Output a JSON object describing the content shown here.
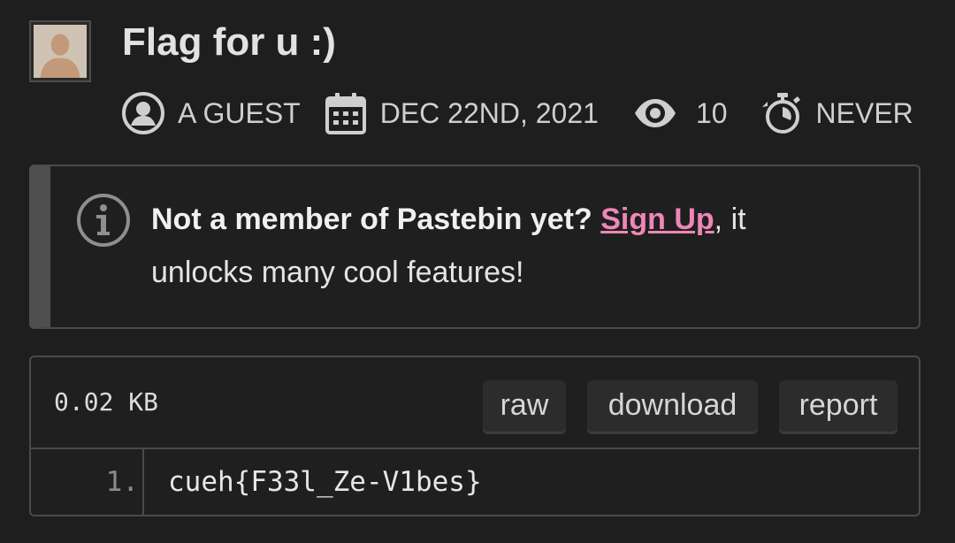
{
  "paste": {
    "title": "Flag for u :)"
  },
  "meta": {
    "user": "A GUEST",
    "date": "DEC 22ND, 2021",
    "views": "10",
    "expiry": "NEVER"
  },
  "notice": {
    "bold_text": "Not a member of Pastebin yet?",
    "link_text": "Sign Up",
    "rest_line1": ", it",
    "rest_line2": "unlocks many cool features!",
    "link_color": "#ee86b7"
  },
  "code": {
    "size": "0.02 KB",
    "buttons": {
      "raw": "raw",
      "download": "download",
      "report": "report"
    },
    "lines": [
      {
        "number": "1.",
        "text": "cueh{F33l_Ze-V1bes}"
      }
    ]
  },
  "icons": {
    "user": "user-circle-icon",
    "date": "calendar-icon",
    "views": "eye-icon",
    "expiry": "stopwatch-icon",
    "notice": "info-icon"
  }
}
